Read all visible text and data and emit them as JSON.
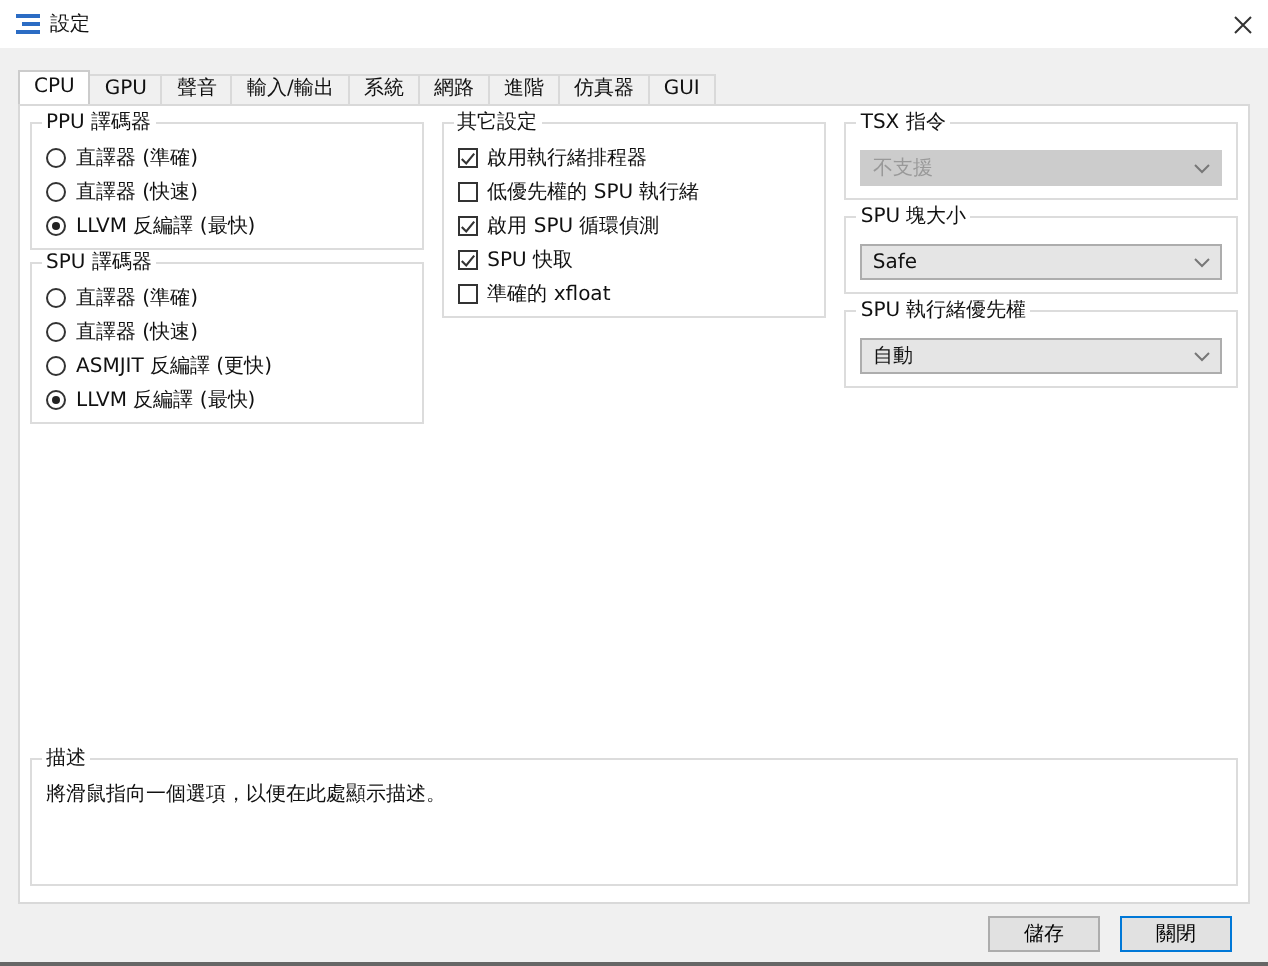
{
  "window": {
    "title": "設定"
  },
  "tabs": [
    {
      "label": "CPU",
      "selected": true
    },
    {
      "label": "GPU",
      "selected": false
    },
    {
      "label": "聲音",
      "selected": false
    },
    {
      "label": "輸入/輸出",
      "selected": false
    },
    {
      "label": "系統",
      "selected": false
    },
    {
      "label": "網路",
      "selected": false
    },
    {
      "label": "進階",
      "selected": false
    },
    {
      "label": "仿真器",
      "selected": false
    },
    {
      "label": "GUI",
      "selected": false
    }
  ],
  "ppu_decoder": {
    "title": "PPU 譯碼器",
    "options": [
      {
        "label": "直譯器 (準確)",
        "selected": false
      },
      {
        "label": "直譯器 (快速)",
        "selected": false
      },
      {
        "label": "LLVM 反編譯 (最快)",
        "selected": true
      }
    ]
  },
  "spu_decoder": {
    "title": "SPU 譯碼器",
    "options": [
      {
        "label": "直譯器 (準確)",
        "selected": false
      },
      {
        "label": "直譯器 (快速)",
        "selected": false
      },
      {
        "label": "ASMJIT 反編譯 (更快)",
        "selected": false
      },
      {
        "label": "LLVM 反編譯 (最快)",
        "selected": true
      }
    ]
  },
  "other_settings": {
    "title": "其它設定",
    "options": [
      {
        "label": "啟用執行緒排程器",
        "checked": true
      },
      {
        "label": "低優先權的 SPU 執行緒",
        "checked": false
      },
      {
        "label": "啟用 SPU 循環偵測",
        "checked": true
      },
      {
        "label": "SPU 快取",
        "checked": true
      },
      {
        "label": "準確的 xfloat",
        "checked": false
      }
    ]
  },
  "dropdowns": [
    {
      "title": "TSX 指令",
      "value": "不支援",
      "disabled": true
    },
    {
      "title": "SPU 塊大小",
      "value": "Safe",
      "disabled": false
    },
    {
      "title": "SPU 執行緒優先權",
      "value": "自動",
      "disabled": false
    }
  ],
  "description": {
    "title": "描述",
    "text": "將滑鼠指向一個選項，以便在此處顯示描述。"
  },
  "buttons": [
    "儲存",
    "關閉"
  ]
}
